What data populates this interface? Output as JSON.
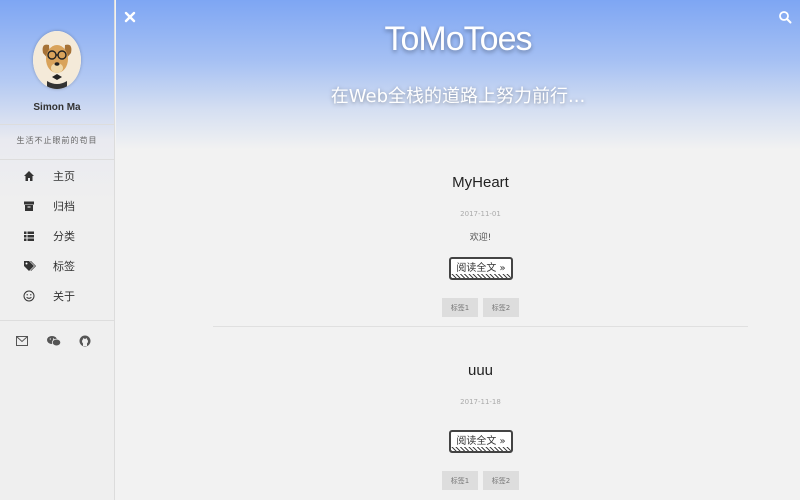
{
  "sidebar": {
    "username": "Simon Ma",
    "motto": "生活不止眼前的苟目",
    "nav": [
      {
        "label": "主页",
        "icon": "home-icon"
      },
      {
        "label": "归档",
        "icon": "archive-icon"
      },
      {
        "label": "分类",
        "icon": "list-icon"
      },
      {
        "label": "标签",
        "icon": "tags-icon"
      },
      {
        "label": "关于",
        "icon": "smile-icon"
      }
    ],
    "social": [
      "mail-icon",
      "wechat-icon",
      "github-icon"
    ]
  },
  "header": {
    "title": "ToMoToes",
    "subtitle": "在Web全栈的道路上努力前行..."
  },
  "posts": [
    {
      "title": "MyHeart",
      "date": "2017-11-01",
      "excerpt": "欢迎!",
      "read_more": "阅读全文 »",
      "tags": [
        "标签1",
        "标签2"
      ]
    },
    {
      "title": "uuu",
      "date": "2017-11-18",
      "excerpt": "",
      "read_more": "阅读全文 »",
      "tags": [
        "标签1",
        "标签2"
      ]
    }
  ],
  "colors": {
    "header_top": "#7ea6f3",
    "background": "#f2f2f2"
  }
}
